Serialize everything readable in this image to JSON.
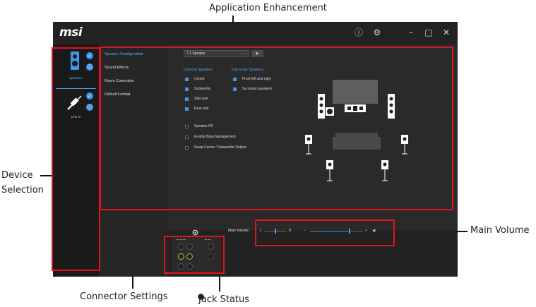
{
  "callouts": {
    "application_enhancement": "Application Enhancement",
    "device_selection_line1": "Device",
    "device_selection_line2": "Selection",
    "main_volume": "Main Volume",
    "connector_settings": "Connector Settings",
    "jack_status": "Jack Status"
  },
  "app": {
    "logo": "msi",
    "titlebar_icons": [
      "info-icon",
      "gear-icon",
      "minimize-icon",
      "maximize-icon",
      "close-icon"
    ],
    "titlebar_glyphs": {
      "info": "ⓘ",
      "gear": "⚙",
      "minimize": "–",
      "maximize": "□",
      "close": "✕"
    }
  },
  "devices": [
    {
      "name": "speaker-icon",
      "label": "Speakers",
      "active": true
    },
    {
      "name": "line-in-icon",
      "label": "Line In",
      "active": false
    }
  ],
  "menu": [
    {
      "label": "Speaker Configuration",
      "active": true
    },
    {
      "label": "Sound Effects",
      "active": false
    },
    {
      "label": "Room Correction",
      "active": false
    },
    {
      "label": "Default Format",
      "active": false
    }
  ],
  "speaker_config": {
    "dropdown_value": "7.1 Speaker",
    "play_glyph": "▶",
    "optional_header": "Optional Speakers",
    "fullrange_header": "Full-range Speakers",
    "optional": [
      {
        "label": "Center",
        "checked": true
      },
      {
        "label": "Subwoofer",
        "checked": true
      },
      {
        "label": "Side pair",
        "checked": true
      },
      {
        "label": "Rear pair",
        "checked": true
      }
    ],
    "fullrange": [
      {
        "label": "Front left and right",
        "checked": true
      },
      {
        "label": "Surround speakers",
        "checked": true
      }
    ],
    "extra": [
      {
        "label": "Speaker Fill",
        "checked": false
      },
      {
        "label": "Enable Bass Management",
        "checked": false
      },
      {
        "label": "Swap Center / Subwoofer Output",
        "checked": false
      }
    ]
  },
  "main_volume": {
    "label": "Main Volume",
    "left_letter": "L",
    "right_letter": "R",
    "minus": "−",
    "plus": "+",
    "balance": 0.5,
    "level": 0.75,
    "speaker_glyph": "◀)"
  },
  "colors": {
    "accent": "#3d97e6",
    "callout_box": "#e1141c",
    "jack_green": "#b5cf3a",
    "jack_orange": "#e39a2a"
  }
}
